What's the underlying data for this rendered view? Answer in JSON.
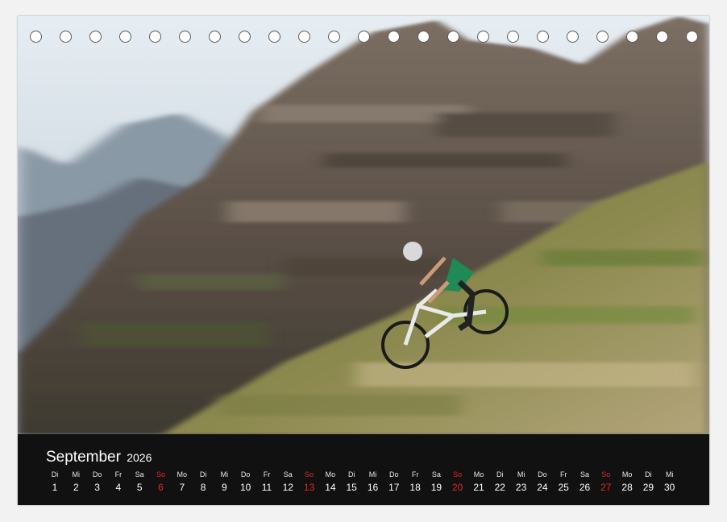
{
  "calendar": {
    "month": "September",
    "year": "2026",
    "days": [
      {
        "wd": "Di",
        "n": "1",
        "sun": false
      },
      {
        "wd": "Mi",
        "n": "2",
        "sun": false
      },
      {
        "wd": "Do",
        "n": "3",
        "sun": false
      },
      {
        "wd": "Fr",
        "n": "4",
        "sun": false
      },
      {
        "wd": "Sa",
        "n": "5",
        "sun": false
      },
      {
        "wd": "So",
        "n": "6",
        "sun": true
      },
      {
        "wd": "Mo",
        "n": "7",
        "sun": false
      },
      {
        "wd": "Di",
        "n": "8",
        "sun": false
      },
      {
        "wd": "Mi",
        "n": "9",
        "sun": false
      },
      {
        "wd": "Do",
        "n": "10",
        "sun": false
      },
      {
        "wd": "Fr",
        "n": "11",
        "sun": false
      },
      {
        "wd": "Sa",
        "n": "12",
        "sun": false
      },
      {
        "wd": "So",
        "n": "13",
        "sun": true
      },
      {
        "wd": "Mo",
        "n": "14",
        "sun": false
      },
      {
        "wd": "Di",
        "n": "15",
        "sun": false
      },
      {
        "wd": "Mi",
        "n": "16",
        "sun": false
      },
      {
        "wd": "Do",
        "n": "17",
        "sun": false
      },
      {
        "wd": "Fr",
        "n": "18",
        "sun": false
      },
      {
        "wd": "Sa",
        "n": "19",
        "sun": false
      },
      {
        "wd": "So",
        "n": "20",
        "sun": true
      },
      {
        "wd": "Mo",
        "n": "21",
        "sun": false
      },
      {
        "wd": "Di",
        "n": "22",
        "sun": false
      },
      {
        "wd": "Mi",
        "n": "23",
        "sun": false
      },
      {
        "wd": "Do",
        "n": "24",
        "sun": false
      },
      {
        "wd": "Fr",
        "n": "25",
        "sun": false
      },
      {
        "wd": "Sa",
        "n": "26",
        "sun": false
      },
      {
        "wd": "So",
        "n": "27",
        "sun": true
      },
      {
        "wd": "Mo",
        "n": "28",
        "sun": false
      },
      {
        "wd": "Di",
        "n": "29",
        "sun": false
      },
      {
        "wd": "Mi",
        "n": "30",
        "sun": false
      }
    ]
  },
  "colors": {
    "band": "#111111",
    "sunday": "#e8262a",
    "jersey": "#1f8a55"
  }
}
